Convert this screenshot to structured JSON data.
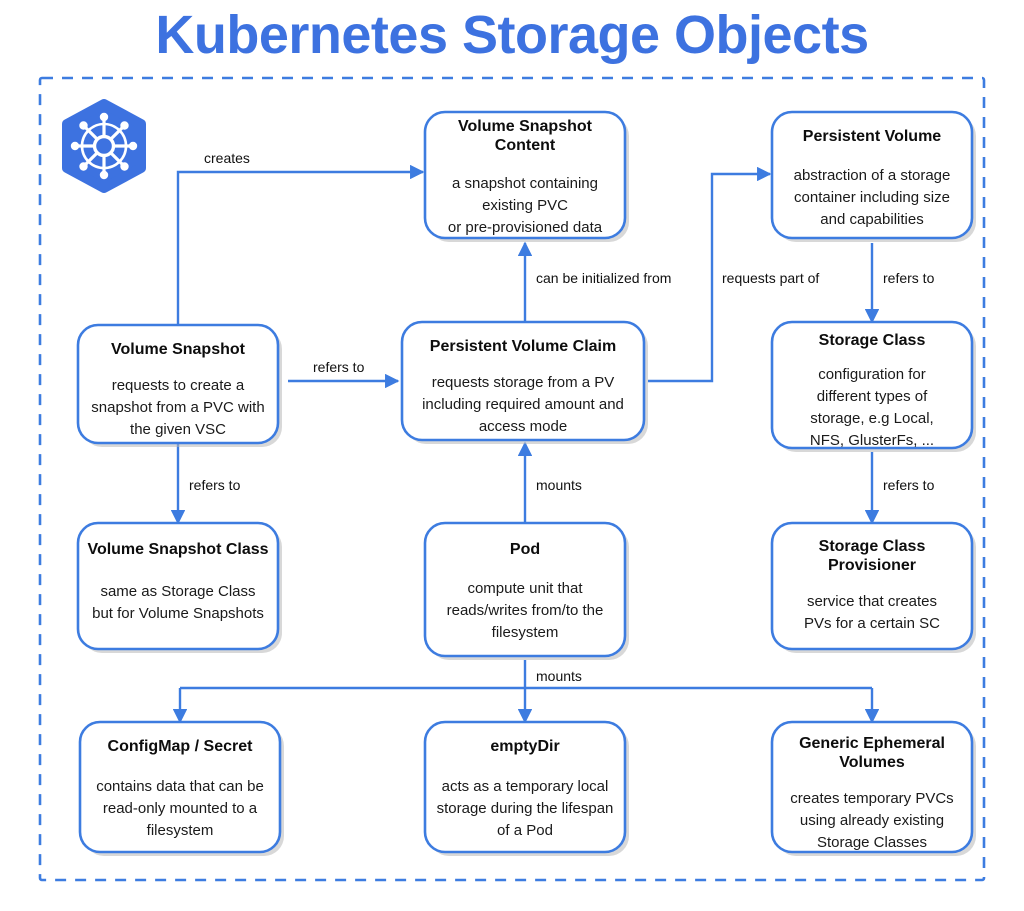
{
  "title": "Kubernetes Storage Objects",
  "colors": {
    "accent": "#3d7ce0",
    "title": "#3d72e0",
    "box_border": "#3d7ce0",
    "box_fill": "#ffffff",
    "text": "#0d0d0d",
    "background": "#ffffff"
  },
  "logo": {
    "name": "kubernetes-logo",
    "label": "Kubernetes"
  },
  "nodes": [
    {
      "id": "volume-snapshot-content",
      "title": "Volume Snapshot Content",
      "title_lines": [
        "Volume Snapshot",
        "Content"
      ],
      "desc_lines": [
        "a snapshot containing",
        "existing PVC",
        "or pre-provisioned data"
      ]
    },
    {
      "id": "persistent-volume",
      "title": "Persistent Volume",
      "title_lines": [
        "Persistent Volume"
      ],
      "desc_lines": [
        "abstraction of a storage",
        "container including size",
        "and capabilities"
      ]
    },
    {
      "id": "volume-snapshot",
      "title": "Volume Snapshot",
      "title_lines": [
        "Volume Snapshot"
      ],
      "desc_lines": [
        "requests to create a",
        "snapshot from a PVC with",
        "the given VSC"
      ]
    },
    {
      "id": "persistent-volume-claim",
      "title": "Persistent Volume Claim",
      "title_lines": [
        "Persistent Volume Claim"
      ],
      "desc_lines": [
        "requests storage from a PV",
        "including required amount and",
        "access mode"
      ]
    },
    {
      "id": "storage-class",
      "title": "Storage Class",
      "title_lines": [
        "Storage Class"
      ],
      "desc_lines": [
        "configuration for",
        "different types of",
        "storage, e.g Local,",
        "NFS, GlusterFs, ..."
      ]
    },
    {
      "id": "volume-snapshot-class",
      "title": "Volume Snapshot Class",
      "title_lines": [
        "Volume Snapshot Class"
      ],
      "desc_lines": [
        "same as Storage Class",
        "but for Volume Snapshots"
      ]
    },
    {
      "id": "pod",
      "title": "Pod",
      "title_lines": [
        "Pod"
      ],
      "desc_lines": [
        "compute unit that",
        "reads/writes from/to the",
        "filesystem"
      ]
    },
    {
      "id": "storage-class-provisioner",
      "title": "Storage Class Provisioner",
      "title_lines": [
        "Storage Class",
        "Provisioner"
      ],
      "desc_lines": [
        "service that creates",
        "PVs for a certain SC"
      ]
    },
    {
      "id": "configmap-secret",
      "title": "ConfigMap / Secret",
      "title_lines": [
        "ConfigMap / Secret"
      ],
      "desc_lines": [
        "contains data that can be",
        "read-only mounted to a",
        "filesystem"
      ]
    },
    {
      "id": "emptydir",
      "title": "emptyDir",
      "title_lines": [
        "emptyDir"
      ],
      "desc_lines": [
        "acts as a temporary local",
        "storage during the lifespan",
        "of a Pod"
      ]
    },
    {
      "id": "generic-ephemeral-volumes",
      "title": "Generic Ephemeral Volumes",
      "title_lines": [
        "Generic Ephemeral",
        "Volumes"
      ],
      "desc_lines": [
        "creates temporary PVCs",
        "using already existing",
        "Storage Classes"
      ]
    }
  ],
  "edges": [
    {
      "id": "volume-snapshot-creates-vsc",
      "label": "creates",
      "from": "volume-snapshot",
      "to": "volume-snapshot-content"
    },
    {
      "id": "pvc-initialized-from-vsc",
      "label": "can be initialized from",
      "from": "persistent-volume-claim",
      "to": "volume-snapshot-content"
    },
    {
      "id": "pvc-requests-part-of-pv",
      "label": "requests part of",
      "from": "persistent-volume-claim",
      "to": "persistent-volume"
    },
    {
      "id": "pv-refers-to-storage-class",
      "label": "refers to",
      "from": "persistent-volume",
      "to": "storage-class"
    },
    {
      "id": "volume-snapshot-refers-to-pvc",
      "label": "refers to",
      "from": "volume-snapshot",
      "to": "persistent-volume-claim"
    },
    {
      "id": "volume-snapshot-refers-to-vsclass",
      "label": "refers to",
      "from": "volume-snapshot",
      "to": "volume-snapshot-class"
    },
    {
      "id": "storage-class-refers-to-provisioner",
      "label": "refers to",
      "from": "storage-class",
      "to": "storage-class-provisioner"
    },
    {
      "id": "pod-mounts-pvc",
      "label": "mounts",
      "from": "pod",
      "to": "persistent-volume-claim"
    },
    {
      "id": "pod-mounts-volumes",
      "label": "mounts",
      "from": "pod",
      "to": "configmap-secret / emptydir / generic-ephemeral-volumes"
    }
  ]
}
